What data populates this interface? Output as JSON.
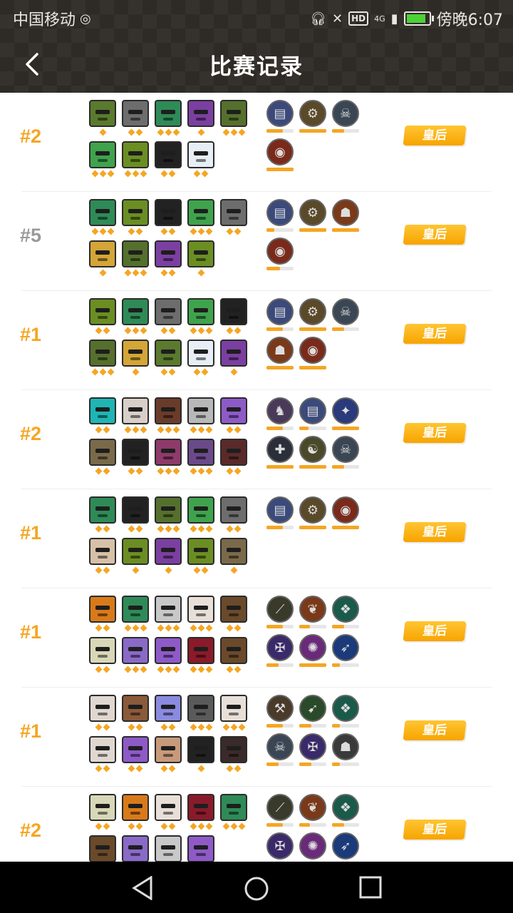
{
  "status_bar": {
    "carrier": "中国移动",
    "net": "4G",
    "hd": "HD",
    "time": "傍晚6:07"
  },
  "header": {
    "title": "比赛记录"
  },
  "colors": {
    "accent": "#f5a623",
    "header_bg": "#2e2a25",
    "rank_gold": "#f5a623",
    "rank_gray": "#9a9a9a"
  },
  "matches": [
    {
      "rank": "#2",
      "badge": "皇后",
      "heroes": [
        {
          "c": "#5a7a2e",
          "s": 1
        },
        {
          "c": "#6d6d6d",
          "s": 2
        },
        {
          "c": "#2e8b57",
          "s": 3
        },
        {
          "c": "#7b3fa1",
          "s": 1
        },
        {
          "c": "#55702d",
          "s": 3
        },
        {
          "c": "#3fa34d",
          "s": 3
        },
        {
          "c": "#6b8e23",
          "s": 3
        },
        {
          "c": "#222222",
          "s": 2
        },
        {
          "c": "#e8eef5",
          "s": 2
        }
      ],
      "synergies": [
        {
          "icon": "▤",
          "col": "#3b4a7a",
          "f": 0.6
        },
        {
          "icon": "⚙",
          "col": "#5a4a2a",
          "f": 1
        },
        {
          "icon": "☠",
          "col": "#3a4654",
          "f": 0.45
        },
        {
          "icon": "◉",
          "col": "#7a2a1a",
          "f": 1
        }
      ]
    },
    {
      "rank": "#5",
      "badge": "皇后",
      "heroes": [
        {
          "c": "#2e8b57",
          "s": 3
        },
        {
          "c": "#6b8e23",
          "s": 2
        },
        {
          "c": "#222222",
          "s": 2
        },
        {
          "c": "#3fa34d",
          "s": 3
        },
        {
          "c": "#6d6d6d",
          "s": 2
        },
        {
          "c": "#d4a537",
          "s": 1
        },
        {
          "c": "#55702d",
          "s": 3
        },
        {
          "c": "#7b3fa1",
          "s": 2
        },
        {
          "c": "#6b8e23",
          "s": 1
        }
      ],
      "synergies": [
        {
          "icon": "▤",
          "col": "#3b4a7a",
          "f": 0.3
        },
        {
          "icon": "⚙",
          "col": "#5a4a2a",
          "f": 1
        },
        {
          "icon": "☗",
          "col": "#7a3a1a",
          "f": 1
        },
        {
          "icon": "◉",
          "col": "#7a2a1a",
          "f": 0.5
        }
      ]
    },
    {
      "rank": "#1",
      "badge": "皇后",
      "heroes": [
        {
          "c": "#6b8e23",
          "s": 2
        },
        {
          "c": "#2e8b57",
          "s": 3
        },
        {
          "c": "#6d6d6d",
          "s": 2
        },
        {
          "c": "#3fa34d",
          "s": 3
        },
        {
          "c": "#222222",
          "s": 2
        },
        {
          "c": "#55702d",
          "s": 3
        },
        {
          "c": "#d4a537",
          "s": 1
        },
        {
          "c": "#5a7a2e",
          "s": 2
        },
        {
          "c": "#e8eef5",
          "s": 2
        },
        {
          "c": "#7b3fa1",
          "s": 1
        }
      ],
      "synergies": [
        {
          "icon": "▤",
          "col": "#3b4a7a",
          "f": 0.6
        },
        {
          "icon": "⚙",
          "col": "#5a4a2a",
          "f": 1
        },
        {
          "icon": "☠",
          "col": "#3a4654",
          "f": 0.45
        },
        {
          "icon": "☗",
          "col": "#7a3a1a",
          "f": 1
        },
        {
          "icon": "◉",
          "col": "#7a2a1a",
          "f": 1
        }
      ]
    },
    {
      "rank": "#2",
      "badge": "皇后",
      "heroes": [
        {
          "c": "#1fb5b5",
          "s": 2
        },
        {
          "c": "#d8d0c8",
          "s": 3
        },
        {
          "c": "#6b3b2a",
          "s": 3
        },
        {
          "c": "#b8b8b8",
          "s": 3
        },
        {
          "c": "#8e5ac8",
          "s": 2
        },
        {
          "c": "#7a6a4a",
          "s": 2
        },
        {
          "c": "#222222",
          "s": 2
        },
        {
          "c": "#8e3a6a",
          "s": 3
        },
        {
          "c": "#6a4a8a",
          "s": 3
        },
        {
          "c": "#5a2a2a",
          "s": 2
        }
      ],
      "synergies": [
        {
          "icon": "♞",
          "col": "#4a3a5a",
          "f": 0.6
        },
        {
          "icon": "▤",
          "col": "#3b4a7a",
          "f": 0.35
        },
        {
          "icon": "✦",
          "col": "#2a3a7a",
          "f": 1
        },
        {
          "icon": "✚",
          "col": "#2a2f3a",
          "f": 1
        },
        {
          "icon": "☯",
          "col": "#4a4a2a",
          "f": 1
        },
        {
          "icon": "☠",
          "col": "#3a4654",
          "f": 0.45
        }
      ]
    },
    {
      "rank": "#1",
      "badge": "皇后",
      "heroes": [
        {
          "c": "#2e8b57",
          "s": 2
        },
        {
          "c": "#222222",
          "s": 2
        },
        {
          "c": "#55702d",
          "s": 3
        },
        {
          "c": "#3fa34d",
          "s": 3
        },
        {
          "c": "#6d6d6d",
          "s": 2
        },
        {
          "c": "#d8c0a8",
          "s": 2
        },
        {
          "c": "#6b8e23",
          "s": 1
        },
        {
          "c": "#7b3fa1",
          "s": 1
        },
        {
          "c": "#6b8e23",
          "s": 2
        },
        {
          "c": "#7a6a4a",
          "s": 1
        }
      ],
      "synergies": [
        {
          "icon": "▤",
          "col": "#3b4a7a",
          "f": 0.6
        },
        {
          "icon": "⚙",
          "col": "#5a4a2a",
          "f": 1
        },
        {
          "icon": "◉",
          "col": "#7a2a1a",
          "f": 1
        }
      ]
    },
    {
      "rank": "#1",
      "badge": "皇后",
      "heroes": [
        {
          "c": "#d97a1a",
          "s": 2
        },
        {
          "c": "#2e8b57",
          "s": 3
        },
        {
          "c": "#c8c8c8",
          "s": 3
        },
        {
          "c": "#e8e0d8",
          "s": 3
        },
        {
          "c": "#6a4a2a",
          "s": 2
        },
        {
          "c": "#d8d8b8",
          "s": 2
        },
        {
          "c": "#8a6ac8",
          "s": 3
        },
        {
          "c": "#8e5ac8",
          "s": 3
        },
        {
          "c": "#8a1a2a",
          "s": 3
        },
        {
          "c": "#6a4a2a",
          "s": 2
        }
      ],
      "synergies": [
        {
          "icon": "⟋",
          "col": "#3a3a2a",
          "f": 0.6
        },
        {
          "icon": "❦",
          "col": "#7a3a1a",
          "f": 0.4
        },
        {
          "icon": "❖",
          "col": "#1a5a4a",
          "f": 0.45
        },
        {
          "icon": "✠",
          "col": "#3a2a6a",
          "f": 0.45
        },
        {
          "icon": "✺",
          "col": "#6a2a7a",
          "f": 1
        },
        {
          "icon": "➶",
          "col": "#1a3a7a",
          "f": 0.3
        }
      ]
    },
    {
      "rank": "#1",
      "badge": "皇后",
      "heroes": [
        {
          "c": "#e0d8d0",
          "s": 2
        },
        {
          "c": "#8a5a3a",
          "s": 2
        },
        {
          "c": "#8a8ae0",
          "s": 2
        },
        {
          "c": "#5a5a5a",
          "s": 3
        },
        {
          "c": "#e8e0d8",
          "s": 3
        },
        {
          "c": "#e0d8d0",
          "s": 2
        },
        {
          "c": "#8e5ac8",
          "s": 2
        },
        {
          "c": "#c89a7a",
          "s": 2
        },
        {
          "c": "#222222",
          "s": 1
        },
        {
          "c": "#3a2a2a",
          "s": 2
        }
      ],
      "synergies": [
        {
          "icon": "⚒",
          "col": "#4a3a2a",
          "f": 0.6
        },
        {
          "icon": "➹",
          "col": "#2a4a2a",
          "f": 0.45
        },
        {
          "icon": "❖",
          "col": "#1a5a4a",
          "f": 0.3
        },
        {
          "icon": "☠",
          "col": "#3a4654",
          "f": 0.45
        },
        {
          "icon": "✠",
          "col": "#3a2a6a",
          "f": 0.45
        },
        {
          "icon": "☗",
          "col": "#3a3a3a",
          "f": 0.3
        }
      ]
    },
    {
      "rank": "#2",
      "badge": "皇后",
      "heroes": [
        {
          "c": "#d8d8b8",
          "s": 2
        },
        {
          "c": "#d97a1a",
          "s": 2
        },
        {
          "c": "#e8e0d8",
          "s": 2
        },
        {
          "c": "#8a1a2a",
          "s": 3
        },
        {
          "c": "#2e8b57",
          "s": 3
        },
        {
          "c": "#6a4a2a",
          "s": 0
        },
        {
          "c": "#8a6ac8",
          "s": 0
        },
        {
          "c": "#c8c8c8",
          "s": 0
        },
        {
          "c": "#8e5ac8",
          "s": 0
        }
      ],
      "synergies": [
        {
          "icon": "⟋",
          "col": "#3a3a2a",
          "f": 0.6
        },
        {
          "icon": "❦",
          "col": "#7a3a1a",
          "f": 0.4
        },
        {
          "icon": "❖",
          "col": "#1a5a4a",
          "f": 0.45
        },
        {
          "icon": "✠",
          "col": "#3a2a6a",
          "f": 0.45
        },
        {
          "icon": "✺",
          "col": "#6a2a7a",
          "f": 1
        },
        {
          "icon": "➶",
          "col": "#1a3a7a",
          "f": 0.3
        }
      ]
    }
  ]
}
